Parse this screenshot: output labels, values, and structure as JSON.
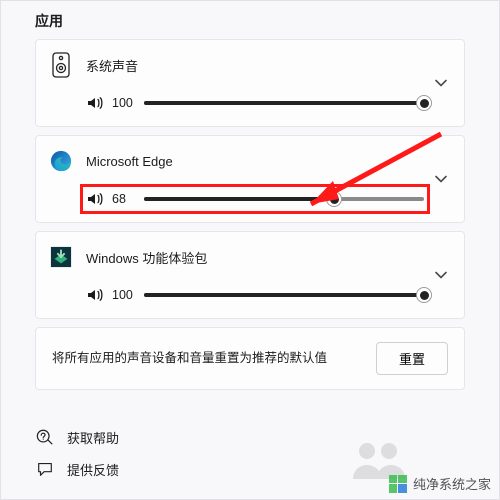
{
  "section_title": "应用",
  "apps": [
    {
      "name": "系统声音",
      "volume": 100,
      "icon": "speaker"
    },
    {
      "name": "Microsoft Edge",
      "volume": 68,
      "icon": "edge",
      "highlight": true
    },
    {
      "name": "Windows 功能体验包",
      "volume": 100,
      "icon": "pkg"
    }
  ],
  "reset": {
    "text": "将所有应用的声音设备和音量重置为推荐的默认值",
    "button": "重置"
  },
  "footer": {
    "help": "获取帮助",
    "feedback": "提供反馈"
  },
  "watermark": "纯净系统之家"
}
